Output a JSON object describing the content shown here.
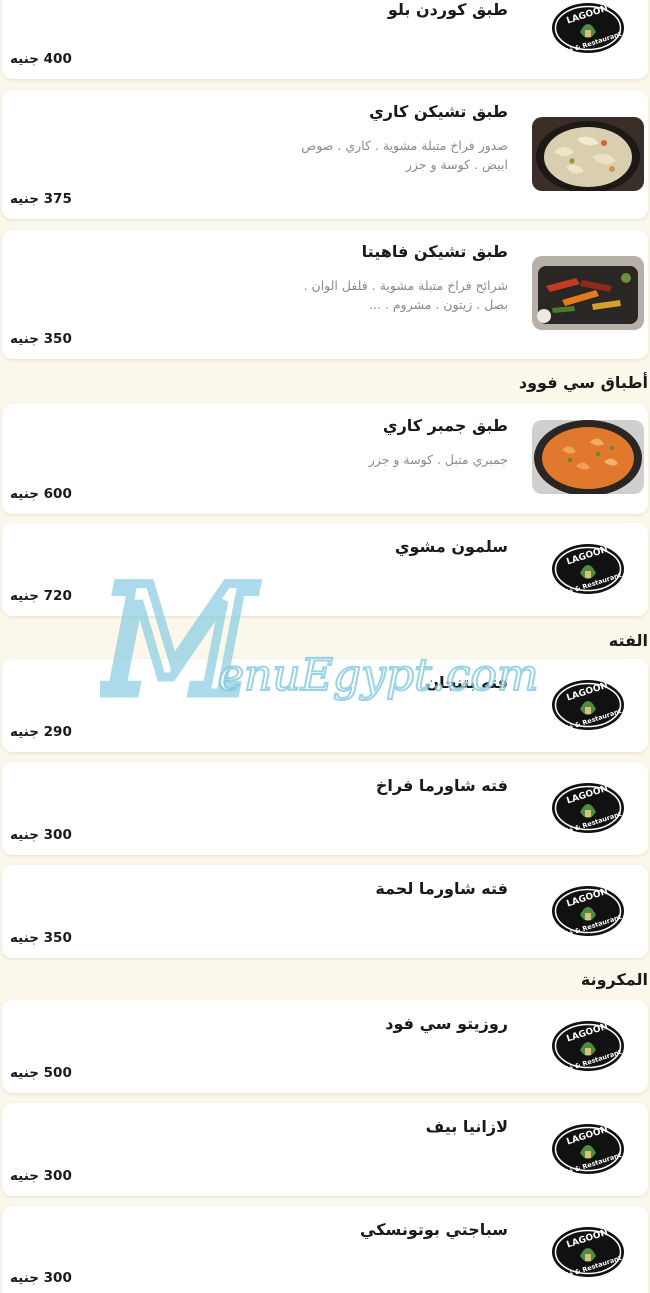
{
  "currency": "جنيه",
  "logo_text": {
    "top": "LAGOON",
    "bottom": "Café & Restaurant"
  },
  "watermark": {
    "letter": "M",
    "text": "enuEgypt.com"
  },
  "colors": {
    "background": "#fbf7ea",
    "card": "#ffffff",
    "watermark": "#7fc9e0",
    "description": "#8a8a8a"
  },
  "items": [
    {
      "name": "طبق كوردن بلو",
      "price": "400",
      "desc": [],
      "image": "logo"
    },
    {
      "name": "طبق تشيكن كاري",
      "price": "375",
      "desc": [
        "صدور فراخ متبلة مشوية . كاري . صوص",
        "ابيض . كوسة و جزر"
      ],
      "image": "curry-chicken-photo"
    },
    {
      "name": "طبق تشيكن فاهيتا",
      "price": "350",
      "desc": [
        "شرائح فراخ متبلة مشوية . فلفل الوان .",
        "بصل . زيتون . مشروم . ..."
      ],
      "image": "fajita-photo"
    },
    {
      "name": "طبق جمبر كاري",
      "price": "600",
      "desc": [
        "جمبري متبل .  كوسة و جزر"
      ],
      "image": "shrimp-curry-photo"
    },
    {
      "name": "سلمون مشوي",
      "price": "720",
      "desc": [],
      "image": "logo"
    },
    {
      "name": "فته بتنجان",
      "price": "290",
      "desc": [],
      "image": "logo"
    },
    {
      "name": "فته شاورما فراخ",
      "price": "300",
      "desc": [],
      "image": "logo"
    },
    {
      "name": "فته شاورما لحمة",
      "price": "350",
      "desc": [],
      "image": "logo"
    },
    {
      "name": "روزيتو سي فود",
      "price": "500",
      "desc": [],
      "image": "logo"
    },
    {
      "name": "لازانيا بيف",
      "price": "300",
      "desc": [],
      "image": "logo"
    },
    {
      "name": "سباجتي بوتونسكي",
      "price": "300",
      "desc": [],
      "image": "logo"
    }
  ],
  "sections": [
    "أطباق سي فوود",
    "الفته",
    "المكرونة"
  ]
}
